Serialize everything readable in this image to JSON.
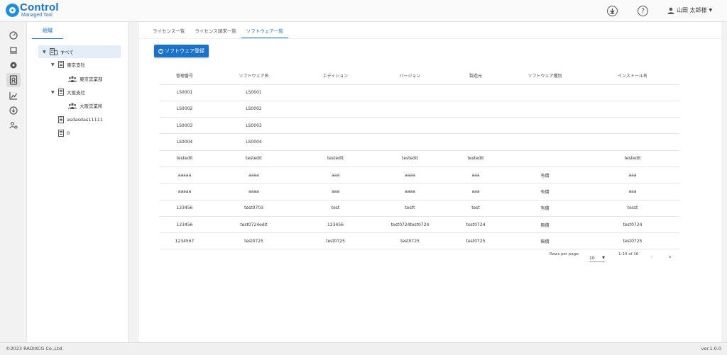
{
  "app": {
    "logo_title": "Control",
    "logo_subtitle": "Managed Tool"
  },
  "header": {
    "user_name": "山田 太郎様",
    "download_icon": "download-icon",
    "help_icon": "help-icon"
  },
  "rail": {
    "icons": [
      "dashboard-icon",
      "computer-icon",
      "circle-icon",
      "license-icon",
      "chart-icon",
      "download-circle-icon",
      "user-settings-icon"
    ]
  },
  "tree": {
    "tab_label": "組織",
    "nodes": [
      {
        "label": "すべて",
        "type": "building"
      },
      {
        "label": "東京支社",
        "type": "office"
      },
      {
        "label": "東京営業部",
        "type": "department"
      },
      {
        "label": "大阪支社",
        "type": "office"
      },
      {
        "label": "大阪営業所",
        "type": "department"
      },
      {
        "label": "asdasdas11111",
        "type": "office"
      },
      {
        "label": "0",
        "type": "office"
      }
    ]
  },
  "main": {
    "tabs": [
      "ライセンス一覧",
      "ライセンス請求一覧",
      "ソフトウェア一覧"
    ],
    "active_tab": 2,
    "register_button": "ソフトウェア登録",
    "table": {
      "headers": [
        "管理番号",
        "ソフトウェア名",
        "エディション",
        "バージョン",
        "製造元",
        "ソフトウェア種別",
        "インストール名"
      ],
      "rows": [
        [
          "LS0001",
          "LS0001",
          "",
          "",
          "",
          "",
          ""
        ],
        [
          "LS0002",
          "LS0002",
          "",
          "",
          "",
          "",
          ""
        ],
        [
          "LS0003",
          "LS0003",
          "",
          "",
          "",
          "",
          ""
        ],
        [
          "LS0004",
          "LS0004",
          "",
          "",
          "",
          "",
          ""
        ],
        [
          "testedit",
          "testedit",
          "testedit",
          "testedit",
          "testedit",
          "",
          "testedit"
        ],
        [
          "aaaaa",
          "aaaa",
          "aaa",
          "aaaa",
          "aaa",
          "有償",
          "aaa"
        ],
        [
          "aaaaa",
          "aaaa",
          "aaa",
          "aaaa",
          "aaa",
          "有償",
          "aaa"
        ],
        [
          "123456",
          "test0703",
          "test",
          "testt",
          "test",
          "有償",
          "tesst"
        ],
        [
          "123456",
          "test0724edit",
          "123456",
          "test0724test0724",
          "test0724",
          "無償",
          "test0724"
        ],
        [
          "1234567",
          "test0725",
          "test0725",
          "test0725",
          "test0725",
          "無償",
          "test0725"
        ]
      ]
    },
    "pagination": {
      "rows_per_page_label": "Rows per page:",
      "rows_per_page": "10",
      "range": "1-10 of 16"
    }
  },
  "footer": {
    "copyright": "©2023 RADIXCG Co.,Ltd.",
    "version": "ver.1.0.0"
  }
}
